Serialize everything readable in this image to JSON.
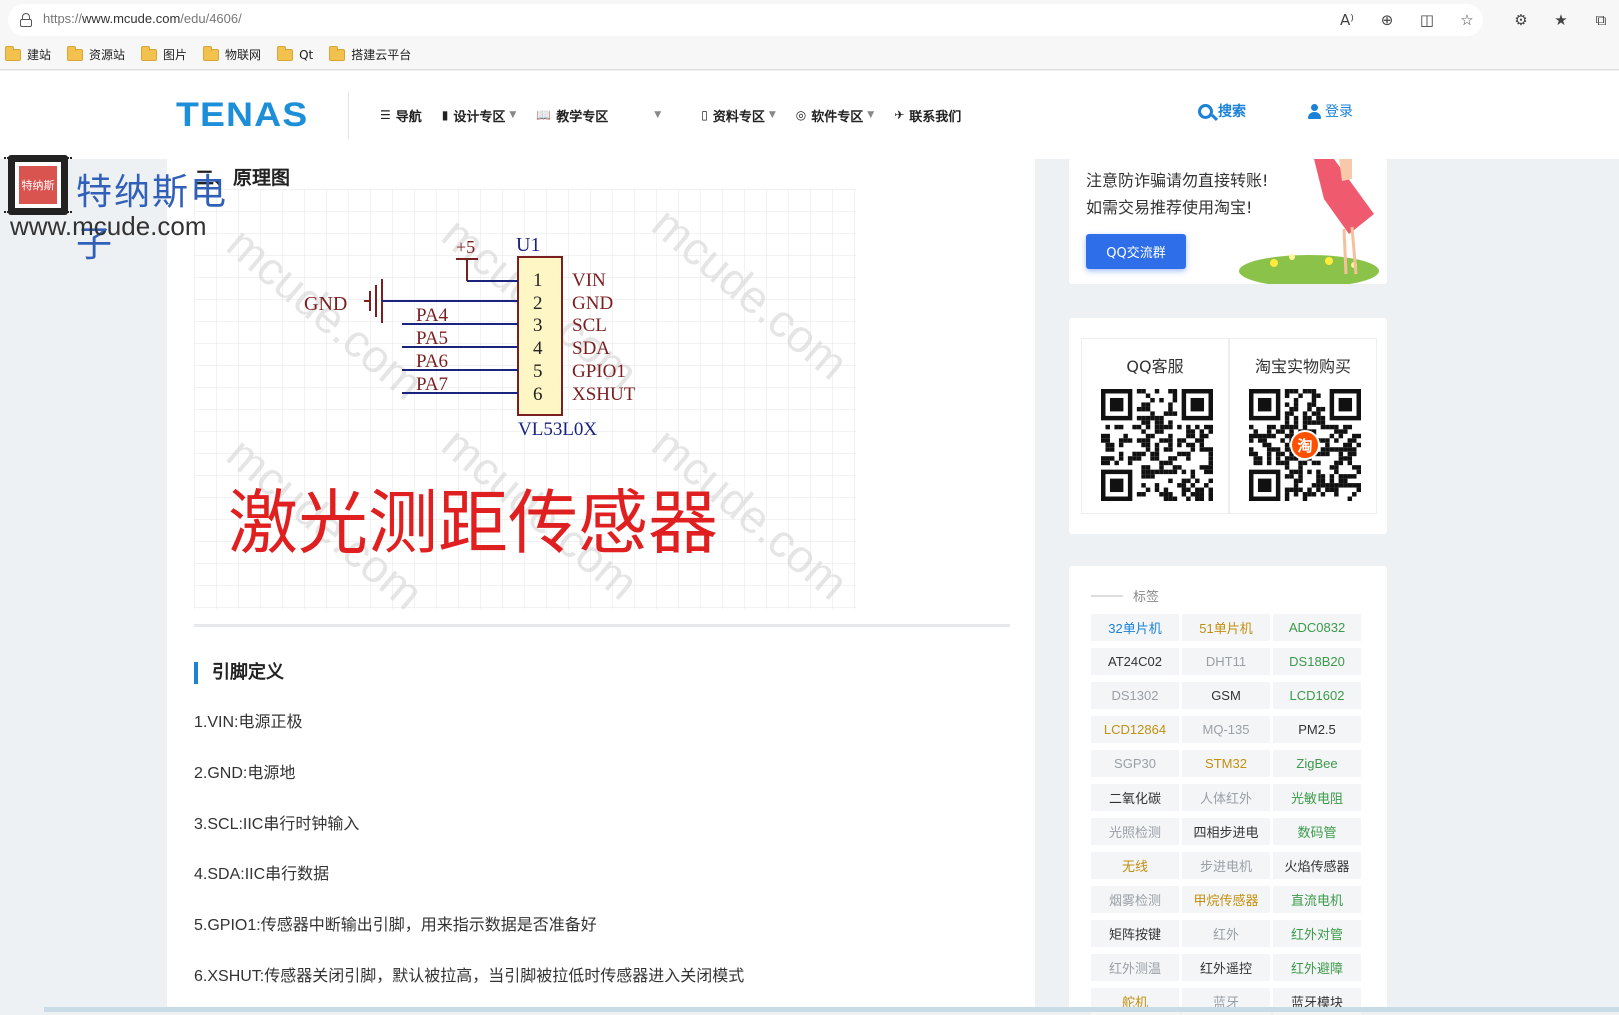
{
  "browser": {
    "url_prefix": "https://",
    "url_domain": "www.mcude.com",
    "url_path": "/edu/4606/",
    "icons": {
      "read_aloud": "A⁾",
      "zoom": "⊕",
      "split": "◫",
      "favorite": "☆",
      "extensions": "⚙",
      "favorites_bar": "★",
      "collections": "⧉"
    }
  },
  "bookmarks": [
    "建站",
    "资源站",
    "图片",
    "物联网",
    "Qt",
    "搭建云平台"
  ],
  "header": {
    "logo": "TENAS",
    "nav": [
      {
        "icon": "☰",
        "label": "导航",
        "caret": false
      },
      {
        "icon": "▮",
        "label": "设计专区",
        "caret": true
      },
      {
        "icon": "📖",
        "label": "教学专区",
        "caret": false
      },
      {
        "icon": "▯",
        "label": "资料专区",
        "caret": true
      },
      {
        "icon": "◎",
        "label": "软件专区",
        "caret": true
      },
      {
        "icon": "✈",
        "label": "联系我们",
        "caret": false
      }
    ],
    "search_label": "搜索",
    "login_label": "登录"
  },
  "watermark": {
    "seal_text": "特纳斯",
    "name": "特纳斯电子",
    "url": "www.mcude.com"
  },
  "article": {
    "section_title": "二、原理图",
    "schematic": {
      "power": "+5",
      "ref": "U1",
      "ground": "GND",
      "part": "VL53L0X",
      "pins": [
        "VIN",
        "GND",
        "SCL",
        "SDA",
        "GPIO1",
        "XSHUT"
      ],
      "nets": [
        "PA4",
        "PA5",
        "PA6",
        "PA7"
      ],
      "caption": "激光测距传感器",
      "wm_text": "mcude.com"
    },
    "subheading": "引脚定义",
    "pins": [
      "1.VIN:电源正极",
      "2.GND:电源地",
      "3.SCL:IIC串行时钟输入",
      "4.SDA:IIC串行数据",
      "5.GPIO1:传感器中断输出引脚，用来指示数据是否准备好",
      "6.XSHUT:传感器关闭引脚，默认被拉高，当引脚被拉低时传感器进入关闭模式"
    ]
  },
  "sidebar": {
    "promo_line1": "注意防诈骗请勿直接转账!",
    "promo_line2": "如需交易推荐使用淘宝!",
    "qq_group_btn": "QQ交流群",
    "qq_service": "QQ客服",
    "taobao_buy": "淘宝实物购买",
    "taobao_mark": "淘",
    "tags_title": "标签",
    "tags": [
      {
        "label": "32单片机",
        "color": "#1b82d8"
      },
      {
        "label": "51单片机",
        "color": "#c28f0f"
      },
      {
        "label": "ADC0832",
        "color": "#3c9a4a"
      },
      {
        "label": "AT24C02",
        "color": "#333333"
      },
      {
        "label": "DHT11",
        "color": "#9aa0a6"
      },
      {
        "label": "DS18B20",
        "color": "#3c9a4a"
      },
      {
        "label": "DS1302",
        "color": "#9aa0a6"
      },
      {
        "label": "GSM",
        "color": "#333333"
      },
      {
        "label": "LCD1602",
        "color": "#3c9a4a"
      },
      {
        "label": "LCD12864",
        "color": "#c28f0f"
      },
      {
        "label": "MQ-135",
        "color": "#9aa0a6"
      },
      {
        "label": "PM2.5",
        "color": "#333333"
      },
      {
        "label": "SGP30",
        "color": "#9aa0a6"
      },
      {
        "label": "STM32",
        "color": "#c28f0f"
      },
      {
        "label": "ZigBee",
        "color": "#3c9a4a"
      },
      {
        "label": "二氧化碳",
        "color": "#333333"
      },
      {
        "label": "人体红外",
        "color": "#9aa0a6"
      },
      {
        "label": "光敏电阻",
        "color": "#3c9a4a"
      },
      {
        "label": "光照检测",
        "color": "#9aa0a6"
      },
      {
        "label": "四相步进电",
        "color": "#333333"
      },
      {
        "label": "数码管",
        "color": "#3c9a4a"
      },
      {
        "label": "无线",
        "color": "#c28f0f"
      },
      {
        "label": "步进电机",
        "color": "#9aa0a6"
      },
      {
        "label": "火焰传感器",
        "color": "#333333"
      },
      {
        "label": "烟雾检测",
        "color": "#9aa0a6"
      },
      {
        "label": "甲烷传感器",
        "color": "#c28f0f"
      },
      {
        "label": "直流电机",
        "color": "#3c9a4a"
      },
      {
        "label": "矩阵按键",
        "color": "#333333"
      },
      {
        "label": "红外",
        "color": "#9aa0a6"
      },
      {
        "label": "红外对管",
        "color": "#3c9a4a"
      },
      {
        "label": "红外测温",
        "color": "#9aa0a6"
      },
      {
        "label": "红外遥控",
        "color": "#333333"
      },
      {
        "label": "红外避障",
        "color": "#3c9a4a"
      },
      {
        "label": "舵机",
        "color": "#c28f0f"
      },
      {
        "label": "蓝牙",
        "color": "#9aa0a6"
      },
      {
        "label": "蓝牙模块",
        "color": "#333333"
      }
    ]
  }
}
